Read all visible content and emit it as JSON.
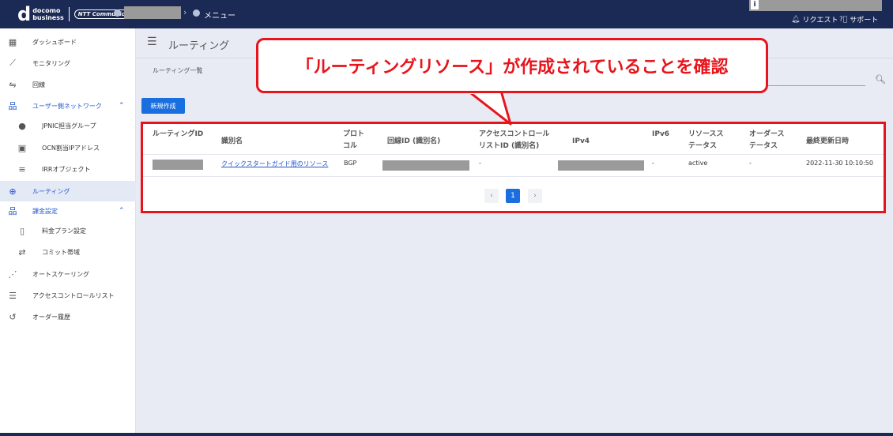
{
  "header": {
    "logo_main": "d",
    "logo_line1": "docomo",
    "logo_line2": "business",
    "logo_ntt": "NTT Communications",
    "breadcrumb_menu": "メニュー",
    "request_label": "リクエスト",
    "support_label": "サポート"
  },
  "sidebar": {
    "items": [
      {
        "label": "ダッシュボード",
        "icon": "dashboard-icon"
      },
      {
        "label": "モニタリング",
        "icon": "chart-line-icon"
      },
      {
        "label": "回線",
        "icon": "line-icon"
      },
      {
        "label": "ユーザー側ネットワーク",
        "icon": "network-icon"
      },
      {
        "label": "JPNIC担当グループ",
        "icon": "person-icon"
      },
      {
        "label": "OCN割当IPアドレス",
        "icon": "monitor-icon"
      },
      {
        "label": "IRRオブジェクト",
        "icon": "database-icon"
      },
      {
        "label": "ルーティング",
        "icon": "routing-icon"
      },
      {
        "label": "課金設定",
        "icon": "network-icon"
      },
      {
        "label": "料金プラン設定",
        "icon": "book-icon"
      },
      {
        "label": "コミット帯域",
        "icon": "link-icon"
      },
      {
        "label": "オートスケーリング",
        "icon": "trend-icon"
      },
      {
        "label": "アクセスコントロールリスト",
        "icon": "list-check-icon"
      },
      {
        "label": "オーダー履歴",
        "icon": "history-icon"
      }
    ]
  },
  "main": {
    "title": "ルーティング",
    "subtitle": "ルーティング一覧",
    "new_button": "新規作成",
    "table": {
      "headers": [
        "ルーティングID",
        "識別名",
        "プロト\nコル",
        "回線ID (識別名)",
        "アクセスコントロール\nリストID (識別名)",
        "IPv4",
        "IPv6",
        "リソースス\nテータス",
        "オーダース\nテータス",
        "最終更新日時"
      ],
      "row": {
        "name": "クイックスタートガイド用のリソース",
        "protocol": "BGP",
        "acl": "-",
        "ipv6": "-",
        "resource_status": "active",
        "order_status": "-",
        "updated": "2022-11-30 10:10:50"
      }
    },
    "pagination": {
      "prev": "‹",
      "current": "1",
      "next": "›"
    }
  },
  "annotation": {
    "callout": "「ルーティングリソース」が作成されていることを確認",
    "color": "#e8141b"
  }
}
